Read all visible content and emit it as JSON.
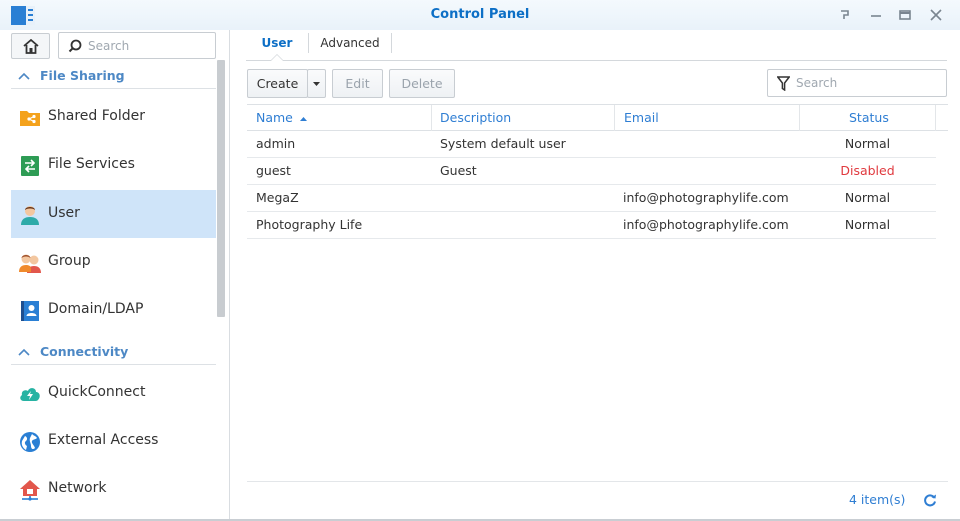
{
  "window": {
    "title": "Control Panel"
  },
  "colors": {
    "accent": "#0d6fc6",
    "link": "#2f7ed3",
    "disabled_status": "#e0393e",
    "active_item": "#cfe4f9"
  },
  "sidebar": {
    "search_placeholder": "Search",
    "sections": [
      {
        "label": "File Sharing",
        "items": [
          {
            "label": "Shared Folder",
            "icon": "shared-folder-icon"
          },
          {
            "label": "File Services",
            "icon": "file-services-icon"
          },
          {
            "label": "User",
            "icon": "user-icon",
            "active": true
          },
          {
            "label": "Group",
            "icon": "group-icon"
          },
          {
            "label": "Domain/LDAP",
            "icon": "domain-ldap-icon"
          }
        ]
      },
      {
        "label": "Connectivity",
        "items": [
          {
            "label": "QuickConnect",
            "icon": "quickconnect-icon"
          },
          {
            "label": "External Access",
            "icon": "external-access-icon"
          },
          {
            "label": "Network",
            "icon": "network-icon"
          }
        ]
      }
    ]
  },
  "tabs": [
    {
      "label": "User",
      "active": true
    },
    {
      "label": "Advanced"
    }
  ],
  "toolbar": {
    "create_label": "Create",
    "edit_label": "Edit",
    "delete_label": "Delete",
    "search_placeholder": "Search"
  },
  "table": {
    "columns": [
      "Name",
      "Description",
      "Email",
      "Status"
    ],
    "sort_column": "Name",
    "rows": [
      {
        "name": "admin",
        "description": "System default user",
        "email": "",
        "status": "Normal"
      },
      {
        "name": "guest",
        "description": "Guest",
        "email": "",
        "status": "Disabled"
      },
      {
        "name": "MegaZ",
        "description": "",
        "email": "info@photographylife.com",
        "status": "Normal"
      },
      {
        "name": "Photography Life",
        "description": "",
        "email": "info@photographylife.com",
        "status": "Normal"
      }
    ]
  },
  "footer": {
    "count": "4 item(s)"
  }
}
